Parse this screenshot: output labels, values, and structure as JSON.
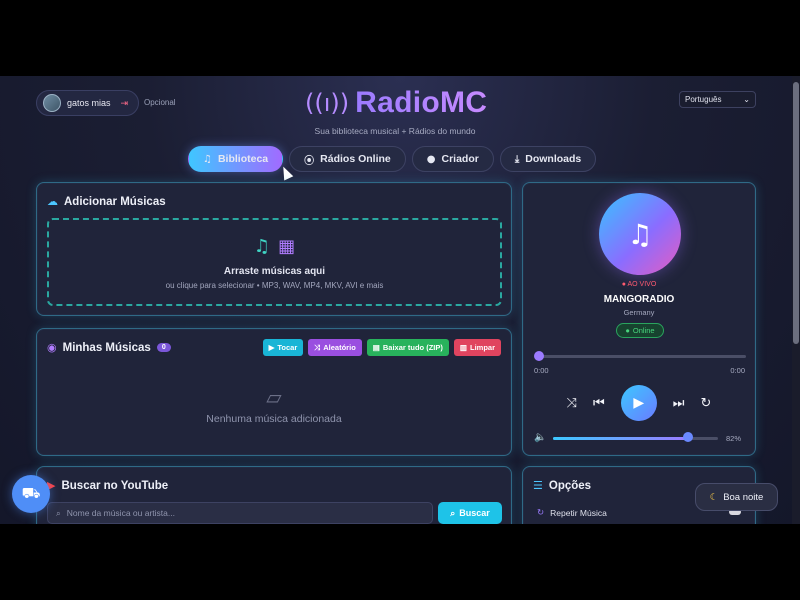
{
  "header": {
    "user_name": "gatos mias",
    "optional_label": "Opcional",
    "logo_icon": "((ı))",
    "app_title": "RadioMC",
    "subtitle": "Sua biblioteca musical + Rádios do mundo",
    "language": "Português"
  },
  "tabs": [
    {
      "label": "Biblioteca",
      "icon": "music-note-icon",
      "active": true
    },
    {
      "label": "Rádios Online",
      "icon": "radio-tower-icon",
      "active": false
    },
    {
      "label": "Criador",
      "icon": "user-icon",
      "active": false
    },
    {
      "label": "Downloads",
      "icon": "download-icon",
      "active": false
    }
  ],
  "add_music": {
    "title": "Adicionar Músicas",
    "drop_title": "Arraste músicas aqui",
    "drop_subtitle": "ou clique para selecionar • MP3, WAV, MP4, MKV, AVI e mais"
  },
  "my_music": {
    "title": "Minhas Músicas",
    "count": "0",
    "play_label": "Tocar",
    "shuffle_label": "Aleatório",
    "zip_label": "Baixar tudo (ZIP)",
    "clear_label": "Limpar",
    "empty_text": "Nenhuma música adicionada"
  },
  "youtube": {
    "title": "Buscar no YouTube",
    "placeholder": "Nome da música ou artista...",
    "search_label": "Buscar"
  },
  "player": {
    "live_label": "AO VIVO",
    "station": "MANGORADIO",
    "country": "Germany",
    "status": "Online",
    "time_current": "0:00",
    "time_total": "0:00",
    "progress": 0,
    "volume_percent": 82,
    "volume_label": "82%"
  },
  "options": {
    "title": "Opções",
    "repeat_label": "Repetir Música"
  },
  "night_mode_label": "Boa noite",
  "colors": {
    "accent_cyan": "#3fc6ff",
    "accent_purple": "#a16bff",
    "success": "#28b25c",
    "danger": "#e0445f"
  }
}
